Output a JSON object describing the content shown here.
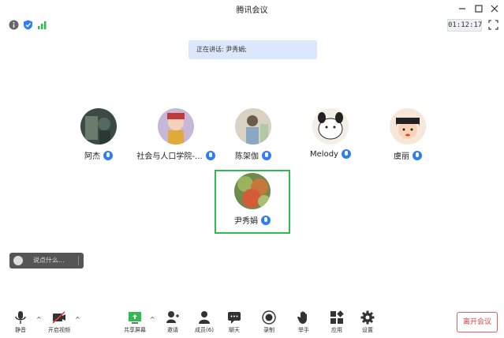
{
  "window": {
    "title": "腾讯会议"
  },
  "status": {
    "timer": "01:12:17"
  },
  "speaking": {
    "text": "正在讲话: 尹秀娟;"
  },
  "participants": [
    {
      "name": "阿杰"
    },
    {
      "name": "社会与人口学院-..."
    },
    {
      "name": "陈架伽"
    },
    {
      "name": "Melody"
    },
    {
      "name": "虞丽"
    },
    {
      "name": "尹秀娟"
    }
  ],
  "chat": {
    "placeholder": "说点什么..."
  },
  "toolbar": {
    "mute": "静音",
    "video": "开启视频",
    "share": "共享屏幕",
    "invite": "邀请",
    "members": "成员(6)",
    "chat": "聊天",
    "record": "录制",
    "raise_hand": "举手",
    "apps": "应用",
    "settings": "设置"
  },
  "leave": {
    "label": "离开会议"
  },
  "colors": {
    "accent": "#2f7df6",
    "active_border": "#2fbb4f",
    "leave": "#e24343"
  }
}
